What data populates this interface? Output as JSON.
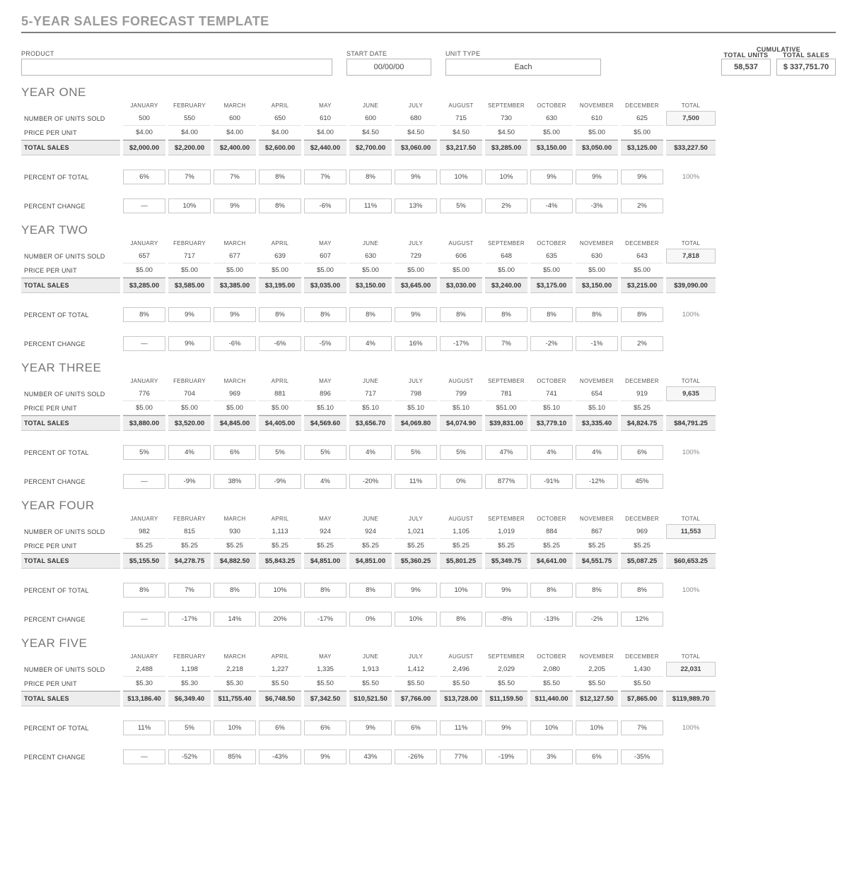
{
  "title": "5-YEAR SALES FORECAST TEMPLATE",
  "header": {
    "product": {
      "label": "PRODUCT",
      "value": ""
    },
    "start": {
      "label": "START DATE",
      "value": "00/00/00"
    },
    "unit": {
      "label": "UNIT TYPE",
      "value": "Each"
    },
    "cumulative_label": "CUMULATIVE",
    "total_units": {
      "label": "TOTAL UNITS",
      "value": "58,537"
    },
    "total_sales": {
      "label": "TOTAL SALES",
      "value": "$ 337,751.70"
    }
  },
  "months": [
    "JANUARY",
    "FEBRUARY",
    "MARCH",
    "APRIL",
    "MAY",
    "JUNE",
    "JULY",
    "AUGUST",
    "SEPTEMBER",
    "OCTOBER",
    "NOVEMBER",
    "DECEMBER",
    "TOTAL"
  ],
  "row_labels": {
    "units": "NUMBER OF UNITS SOLD",
    "price": "PRICE PER UNIT",
    "sales": "TOTAL SALES",
    "pct": "PERCENT OF TOTAL",
    "chg": "PERCENT CHANGE"
  },
  "years": [
    {
      "title": "YEAR ONE",
      "units": [
        "500",
        "550",
        "600",
        "650",
        "610",
        "600",
        "680",
        "715",
        "730",
        "630",
        "610",
        "625",
        "7,500"
      ],
      "price": [
        "$4.00",
        "$4.00",
        "$4.00",
        "$4.00",
        "$4.00",
        "$4.50",
        "$4.50",
        "$4.50",
        "$4.50",
        "$5.00",
        "$5.00",
        "$5.00",
        ""
      ],
      "sales": [
        "$2,000.00",
        "$2,200.00",
        "$2,400.00",
        "$2,600.00",
        "$2,440.00",
        "$2,700.00",
        "$3,060.00",
        "$3,217.50",
        "$3,285.00",
        "$3,150.00",
        "$3,050.00",
        "$3,125.00",
        "$33,227.50"
      ],
      "pct": [
        "6%",
        "7%",
        "7%",
        "8%",
        "7%",
        "8%",
        "9%",
        "10%",
        "10%",
        "9%",
        "9%",
        "9%",
        "100%"
      ],
      "chg": [
        "—",
        "10%",
        "9%",
        "8%",
        "-6%",
        "11%",
        "13%",
        "5%",
        "2%",
        "-4%",
        "-3%",
        "2%",
        ""
      ]
    },
    {
      "title": "YEAR TWO",
      "units": [
        "657",
        "717",
        "677",
        "639",
        "607",
        "630",
        "729",
        "606",
        "648",
        "635",
        "630",
        "643",
        "7,818"
      ],
      "price": [
        "$5.00",
        "$5.00",
        "$5.00",
        "$5.00",
        "$5.00",
        "$5.00",
        "$5.00",
        "$5.00",
        "$5.00",
        "$5.00",
        "$5.00",
        "$5.00",
        ""
      ],
      "sales": [
        "$3,285.00",
        "$3,585.00",
        "$3,385.00",
        "$3,195.00",
        "$3,035.00",
        "$3,150.00",
        "$3,645.00",
        "$3,030.00",
        "$3,240.00",
        "$3,175.00",
        "$3,150.00",
        "$3,215.00",
        "$39,090.00"
      ],
      "pct": [
        "8%",
        "9%",
        "9%",
        "8%",
        "8%",
        "8%",
        "9%",
        "8%",
        "8%",
        "8%",
        "8%",
        "8%",
        "100%"
      ],
      "chg": [
        "—",
        "9%",
        "-6%",
        "-6%",
        "-5%",
        "4%",
        "16%",
        "-17%",
        "7%",
        "-2%",
        "-1%",
        "2%",
        ""
      ]
    },
    {
      "title": "YEAR THREE",
      "units": [
        "776",
        "704",
        "969",
        "881",
        "896",
        "717",
        "798",
        "799",
        "781",
        "741",
        "654",
        "919",
        "9,635"
      ],
      "price": [
        "$5.00",
        "$5.00",
        "$5.00",
        "$5.00",
        "$5.10",
        "$5.10",
        "$5.10",
        "$5.10",
        "$51.00",
        "$5.10",
        "$5.10",
        "$5.25",
        ""
      ],
      "sales": [
        "$3,880.00",
        "$3,520.00",
        "$4,845.00",
        "$4,405.00",
        "$4,569.60",
        "$3,656.70",
        "$4,069.80",
        "$4,074.90",
        "$39,831.00",
        "$3,779.10",
        "$3,335.40",
        "$4,824.75",
        "$84,791.25"
      ],
      "pct": [
        "5%",
        "4%",
        "6%",
        "5%",
        "5%",
        "4%",
        "5%",
        "5%",
        "47%",
        "4%",
        "4%",
        "6%",
        "100%"
      ],
      "chg": [
        "—",
        "-9%",
        "38%",
        "-9%",
        "4%",
        "-20%",
        "11%",
        "0%",
        "877%",
        "-91%",
        "-12%",
        "45%",
        ""
      ]
    },
    {
      "title": "YEAR FOUR",
      "units": [
        "982",
        "815",
        "930",
        "1,113",
        "924",
        "924",
        "1,021",
        "1,105",
        "1,019",
        "884",
        "867",
        "969",
        "11,553"
      ],
      "price": [
        "$5.25",
        "$5.25",
        "$5.25",
        "$5.25",
        "$5.25",
        "$5.25",
        "$5.25",
        "$5.25",
        "$5.25",
        "$5.25",
        "$5.25",
        "$5.25",
        ""
      ],
      "sales": [
        "$5,155.50",
        "$4,278.75",
        "$4,882.50",
        "$5,843.25",
        "$4,851.00",
        "$4,851.00",
        "$5,360.25",
        "$5,801.25",
        "$5,349.75",
        "$4,641.00",
        "$4,551.75",
        "$5,087.25",
        "$60,653.25"
      ],
      "pct": [
        "8%",
        "7%",
        "8%",
        "10%",
        "8%",
        "8%",
        "9%",
        "10%",
        "9%",
        "8%",
        "8%",
        "8%",
        "100%"
      ],
      "chg": [
        "—",
        "-17%",
        "14%",
        "20%",
        "-17%",
        "0%",
        "10%",
        "8%",
        "-8%",
        "-13%",
        "-2%",
        "12%",
        ""
      ]
    },
    {
      "title": "YEAR FIVE",
      "units": [
        "2,488",
        "1,198",
        "2,218",
        "1,227",
        "1,335",
        "1,913",
        "1,412",
        "2,496",
        "2,029",
        "2,080",
        "2,205",
        "1,430",
        "22,031"
      ],
      "price": [
        "$5.30",
        "$5.30",
        "$5.30",
        "$5.50",
        "$5.50",
        "$5.50",
        "$5.50",
        "$5.50",
        "$5.50",
        "$5.50",
        "$5.50",
        "$5.50",
        ""
      ],
      "sales": [
        "$13,186.40",
        "$6,349.40",
        "$11,755.40",
        "$6,748.50",
        "$7,342.50",
        "$10,521.50",
        "$7,766.00",
        "$13,728.00",
        "$11,159.50",
        "$11,440.00",
        "$12,127.50",
        "$7,865.00",
        "$119,989.70"
      ],
      "pct": [
        "11%",
        "5%",
        "10%",
        "6%",
        "6%",
        "9%",
        "6%",
        "11%",
        "9%",
        "10%",
        "10%",
        "7%",
        "100%"
      ],
      "chg": [
        "—",
        "-52%",
        "85%",
        "-43%",
        "9%",
        "43%",
        "-26%",
        "77%",
        "-19%",
        "3%",
        "6%",
        "-35%",
        ""
      ]
    }
  ]
}
